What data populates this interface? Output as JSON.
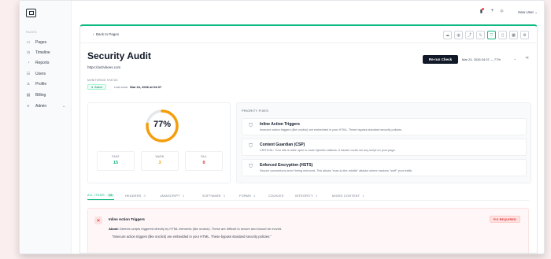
{
  "sidebar": {
    "section_label": "PAGES",
    "items": [
      {
        "label": "Pages",
        "icon": "file-icon"
      },
      {
        "label": "Timeline",
        "icon": "clock-icon"
      },
      {
        "label": "Reports",
        "icon": "chart-icon"
      },
      {
        "label": "Users",
        "icon": "users-icon"
      },
      {
        "label": "Profile",
        "icon": "person-icon"
      },
      {
        "label": "Billing",
        "icon": "card-icon"
      },
      {
        "label": "Admin",
        "icon": "sliders-icon"
      }
    ]
  },
  "topbar": {
    "user_label": "New User"
  },
  "page": {
    "back_label": "Back to Pages",
    "title": "Security Audit",
    "url": "https://activbees.com",
    "rerun_label": "Re-run Check",
    "date_select": "Mar 24, 2026 04:37 — 77%",
    "monitoring_label": "MONITORING STATUS",
    "status_badge": "Active",
    "last_scan_label": "Last scan:",
    "last_scan_value": "Mar 24, 2026 at 04:37"
  },
  "score": {
    "percent_label": "77%",
    "percent": 77,
    "accent": "#f59e0b",
    "pass_label": "PASS",
    "pass_value": "15",
    "warn_label": "WARN",
    "warn_value": "3",
    "fail_label": "FAIL",
    "fail_value": "0"
  },
  "priority": {
    "title": "PRIORITY FIXES",
    "items": [
      {
        "title": "Inline Action Triggers",
        "desc": "Insecure action triggers (like onclick) are embedded in your HTML. These bypass standard security policies."
      },
      {
        "title": "Content Guardian (CSP)",
        "desc": "CRITICAL: Your site is wide open to code injection attacks. A hacker could run any script on your page."
      },
      {
        "title": "Enforced Encryption (HSTS)",
        "desc": "Secure connections aren't being enforced. This allows \"man-in-the-middle\" attacks where hackers \"sniff\" your traffic."
      }
    ]
  },
  "tabs": [
    {
      "label": "ALL ITEMS",
      "count": "18"
    },
    {
      "label": "HEADERS",
      "count": "3"
    },
    {
      "label": "JAVASCRIPT",
      "count": "4"
    },
    {
      "label": "SOFTWARE",
      "count": "3"
    },
    {
      "label": "FORMS",
      "count": "4"
    },
    {
      "label": "COOKIES",
      "count": ""
    },
    {
      "label": "INTEGRITY",
      "count": "3"
    },
    {
      "label": "MIXED CONTENT",
      "count": "1"
    }
  ],
  "issue": {
    "title": "Inline Action Triggers",
    "about_label": "About:",
    "about_text": "Detects scripts triggered directly by HTML elements (like onclick). These are difficult to secure and should be moved.",
    "quote": "\"Insecure action triggers (like onclick) are embedded in your HTML. These bypass standard security policies.\"",
    "badge": "FIX REQUIRED"
  },
  "colors": {
    "accent": "#10b981",
    "warn": "#f59e0b",
    "fail": "#dc2626"
  }
}
